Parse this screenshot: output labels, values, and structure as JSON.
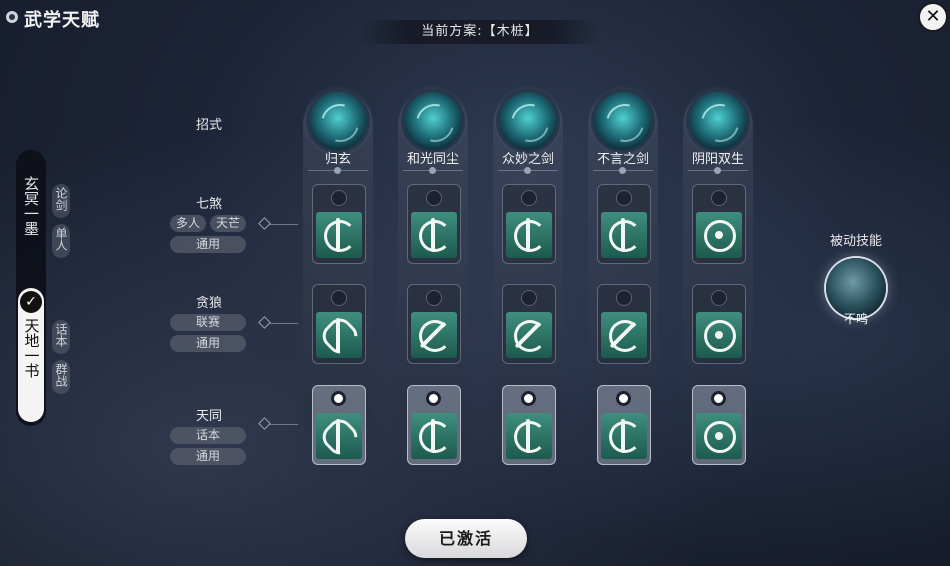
{
  "header": {
    "title": "武学天赋",
    "plan_label": "当前方案:【木桩】"
  },
  "side_tabs": {
    "tab1": {
      "label": "玄冥一墨",
      "tags": [
        "论剑",
        "单人"
      ]
    },
    "tab2": {
      "label": "天地一书",
      "selected": true,
      "tags": [
        "话本",
        "群战"
      ]
    }
  },
  "row_header": "招式",
  "rows": [
    {
      "label": "七煞",
      "tags": [
        "多人",
        "天芒"
      ],
      "mode": "通用"
    },
    {
      "label": "贪狼",
      "tags": [
        "联赛"
      ],
      "mode": "通用"
    },
    {
      "label": "天同",
      "tags": [
        "话本"
      ],
      "mode": "通用"
    }
  ],
  "skills": [
    "归玄",
    "和光同尘",
    "众妙之剑",
    "不言之剑",
    "阴阳双生"
  ],
  "passive": {
    "title": "被动技能",
    "name": "不鸣"
  },
  "activate_button": "已激活",
  "icons": {
    "close": "close-icon",
    "check": "check-icon",
    "title": "gear-icon"
  },
  "colors": {
    "emblem": "#2e7a6a",
    "accent": "#4fd0cf"
  }
}
